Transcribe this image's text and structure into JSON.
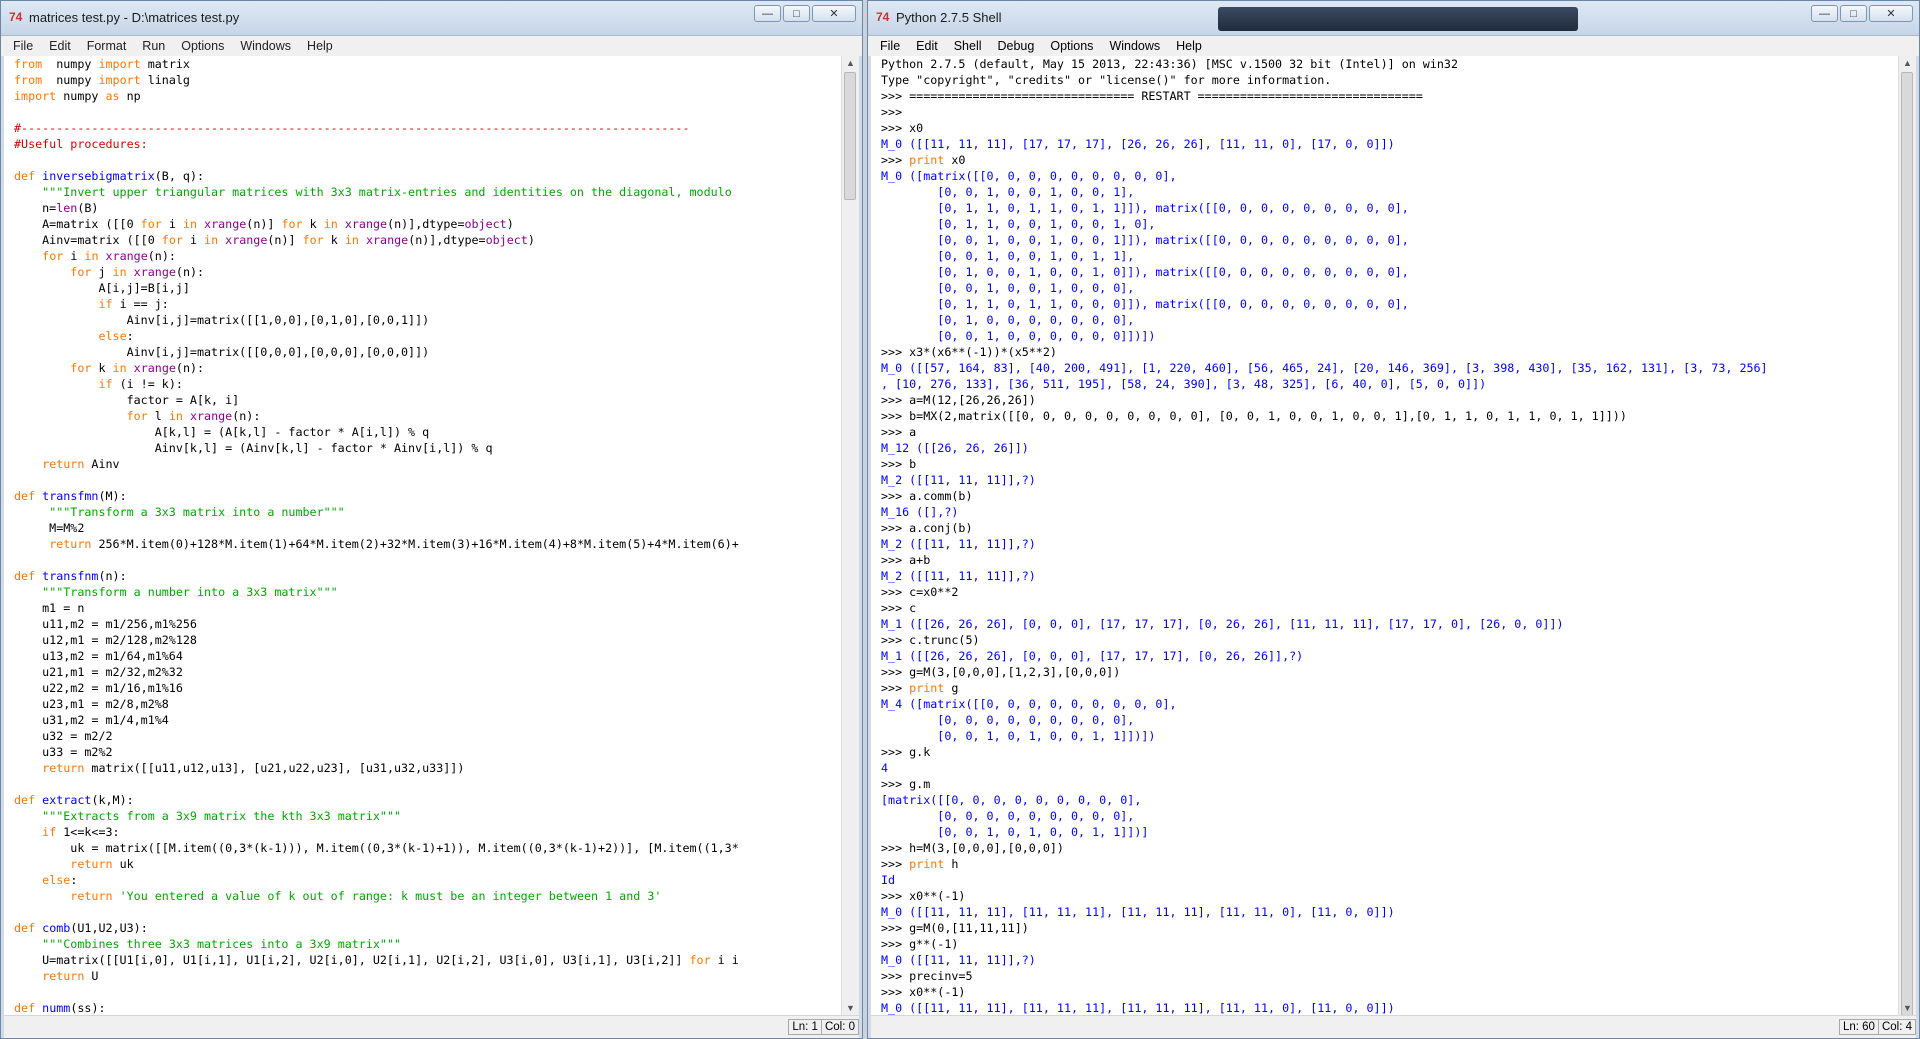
{
  "left_window": {
    "title": "matrices test.py - D:\\matrices test.py",
    "menu": [
      "File",
      "Edit",
      "Format",
      "Run",
      "Options",
      "Windows",
      "Help"
    ],
    "status": {
      "line": "Ln: 1",
      "col": "Col: 0"
    },
    "code_lines": [
      [
        [
          "kw",
          "from"
        ],
        [
          "",
          "  numpy "
        ],
        [
          "kw",
          "import"
        ],
        [
          "",
          " matrix"
        ]
      ],
      [
        [
          "kw",
          "from"
        ],
        [
          "",
          "  numpy "
        ],
        [
          "kw",
          "import"
        ],
        [
          "",
          " linalg"
        ]
      ],
      [
        [
          "kw",
          "import"
        ],
        [
          "",
          " numpy "
        ],
        [
          "kw",
          "as"
        ],
        [
          "",
          " np"
        ]
      ],
      [],
      [
        [
          "cm",
          "#-----------------------------------------------------------------------------------------------"
        ]
      ],
      [
        [
          "cm",
          "#Useful procedures:"
        ]
      ],
      [],
      [
        [
          "kw",
          "def"
        ],
        [
          "",
          " "
        ],
        [
          "df",
          "inversebigmatrix"
        ],
        [
          "",
          "(B, q):"
        ]
      ],
      [
        [
          "",
          "    "
        ],
        [
          "st",
          "\"\"\"Invert upper triangular matrices with 3x3 matrix-entries and identities on the diagonal, modulo"
        ]
      ],
      [
        [
          "",
          "    n="
        ],
        [
          "bi",
          "len"
        ],
        [
          "",
          "(B)"
        ]
      ],
      [
        [
          "",
          "    A=matrix ([[0 "
        ],
        [
          "kw",
          "for"
        ],
        [
          "",
          " i "
        ],
        [
          "kw",
          "in"
        ],
        [
          "",
          " "
        ],
        [
          "bi",
          "xrange"
        ],
        [
          "",
          "(n)] "
        ],
        [
          "kw",
          "for"
        ],
        [
          "",
          " k "
        ],
        [
          "kw",
          "in"
        ],
        [
          "",
          " "
        ],
        [
          "bi",
          "xrange"
        ],
        [
          "",
          "(n)],dtype="
        ],
        [
          "bi",
          "object"
        ],
        [
          "",
          ")"
        ]
      ],
      [
        [
          "",
          "    Ainv=matrix ([[0 "
        ],
        [
          "kw",
          "for"
        ],
        [
          "",
          " i "
        ],
        [
          "kw",
          "in"
        ],
        [
          "",
          " "
        ],
        [
          "bi",
          "xrange"
        ],
        [
          "",
          "(n)] "
        ],
        [
          "kw",
          "for"
        ],
        [
          "",
          " k "
        ],
        [
          "kw",
          "in"
        ],
        [
          "",
          " "
        ],
        [
          "bi",
          "xrange"
        ],
        [
          "",
          "(n)],dtype="
        ],
        [
          "bi",
          "object"
        ],
        [
          "",
          ")"
        ]
      ],
      [
        [
          "",
          "    "
        ],
        [
          "kw",
          "for"
        ],
        [
          "",
          " i "
        ],
        [
          "kw",
          "in"
        ],
        [
          "",
          " "
        ],
        [
          "bi",
          "xrange"
        ],
        [
          "",
          "(n):"
        ]
      ],
      [
        [
          "",
          "        "
        ],
        [
          "kw",
          "for"
        ],
        [
          "",
          " j "
        ],
        [
          "kw",
          "in"
        ],
        [
          "",
          " "
        ],
        [
          "bi",
          "xrange"
        ],
        [
          "",
          "(n):"
        ]
      ],
      [
        [
          "",
          "            A[i,j]=B[i,j]"
        ]
      ],
      [
        [
          "",
          "            "
        ],
        [
          "kw",
          "if"
        ],
        [
          "",
          " i == j:"
        ]
      ],
      [
        [
          "",
          "                Ainv[i,j]=matrix([[1,0,0],[0,1,0],[0,0,1]])"
        ]
      ],
      [
        [
          "",
          "            "
        ],
        [
          "kw",
          "else"
        ],
        [
          "",
          ":"
        ]
      ],
      [
        [
          "",
          "                Ainv[i,j]=matrix([[0,0,0],[0,0,0],[0,0,0]])"
        ]
      ],
      [
        [
          "",
          "        "
        ],
        [
          "kw",
          "for"
        ],
        [
          "",
          " k "
        ],
        [
          "kw",
          "in"
        ],
        [
          "",
          " "
        ],
        [
          "bi",
          "xrange"
        ],
        [
          "",
          "(n):"
        ]
      ],
      [
        [
          "",
          "            "
        ],
        [
          "kw",
          "if"
        ],
        [
          "",
          " (i != k):"
        ]
      ],
      [
        [
          "",
          "                factor = A[k, i]"
        ]
      ],
      [
        [
          "",
          "                "
        ],
        [
          "kw",
          "for"
        ],
        [
          "",
          " l "
        ],
        [
          "kw",
          "in"
        ],
        [
          "",
          " "
        ],
        [
          "bi",
          "xrange"
        ],
        [
          "",
          "(n):"
        ]
      ],
      [
        [
          "",
          "                    A[k,l] = (A[k,l] - factor * A[i,l]) % q"
        ]
      ],
      [
        [
          "",
          "                    Ainv[k,l] = (Ainv[k,l] - factor * Ainv[i,l]) % q"
        ]
      ],
      [
        [
          "",
          "    "
        ],
        [
          "kw",
          "return"
        ],
        [
          "",
          " Ainv"
        ]
      ],
      [],
      [
        [
          "kw",
          "def"
        ],
        [
          "",
          " "
        ],
        [
          "df",
          "transfmn"
        ],
        [
          "",
          "(M):"
        ]
      ],
      [
        [
          "",
          "     "
        ],
        [
          "st",
          "\"\"\"Transform a 3x3 matrix into a number\"\"\""
        ]
      ],
      [
        [
          "",
          "     M=M%2"
        ]
      ],
      [
        [
          "",
          "     "
        ],
        [
          "kw",
          "return"
        ],
        [
          "",
          " 256*M.item(0)+128*M.item(1)+64*M.item(2)+32*M.item(3)+16*M.item(4)+8*M.item(5)+4*M.item(6)+"
        ]
      ],
      [],
      [
        [
          "kw",
          "def"
        ],
        [
          "",
          " "
        ],
        [
          "df",
          "transfnm"
        ],
        [
          "",
          "(n):"
        ]
      ],
      [
        [
          "",
          "    "
        ],
        [
          "st",
          "\"\"\"Transform a number into a 3x3 matrix\"\"\""
        ]
      ],
      [
        [
          "",
          "    m1 = n"
        ]
      ],
      [
        [
          "",
          "    u11,m2 = m1/256,m1%256"
        ]
      ],
      [
        [
          "",
          "    u12,m1 = m2/128,m2%128"
        ]
      ],
      [
        [
          "",
          "    u13,m2 = m1/64,m1%64"
        ]
      ],
      [
        [
          "",
          "    u21,m1 = m2/32,m2%32"
        ]
      ],
      [
        [
          "",
          "    u22,m2 = m1/16,m1%16"
        ]
      ],
      [
        [
          "",
          "    u23,m1 = m2/8,m2%8"
        ]
      ],
      [
        [
          "",
          "    u31,m2 = m1/4,m1%4"
        ]
      ],
      [
        [
          "",
          "    u32 = m2/2"
        ]
      ],
      [
        [
          "",
          "    u33 = m2%2"
        ]
      ],
      [
        [
          "",
          "    "
        ],
        [
          "kw",
          "return"
        ],
        [
          "",
          " matrix([[u11,u12,u13], [u21,u22,u23], [u31,u32,u33]])"
        ]
      ],
      [],
      [
        [
          "kw",
          "def"
        ],
        [
          "",
          " "
        ],
        [
          "df",
          "extract"
        ],
        [
          "",
          "(k,M):"
        ]
      ],
      [
        [
          "",
          "    "
        ],
        [
          "st",
          "\"\"\"Extracts from a 3x9 matrix the kth 3x3 matrix\"\"\""
        ]
      ],
      [
        [
          "",
          "    "
        ],
        [
          "kw",
          "if"
        ],
        [
          "",
          " 1<=k<=3:"
        ]
      ],
      [
        [
          "",
          "        uk = matrix([[M.item((0,3*(k-1))), M.item((0,3*(k-1)+1)), M.item((0,3*(k-1)+2))], [M.item((1,3*"
        ]
      ],
      [
        [
          "",
          "        "
        ],
        [
          "kw",
          "return"
        ],
        [
          "",
          " uk"
        ]
      ],
      [
        [
          "",
          "    "
        ],
        [
          "kw",
          "else"
        ],
        [
          "",
          ":"
        ]
      ],
      [
        [
          "",
          "        "
        ],
        [
          "kw",
          "return"
        ],
        [
          "",
          " "
        ],
        [
          "st",
          "'You entered a value of k out of range: k must be an integer between 1 and 3'"
        ]
      ],
      [],
      [
        [
          "kw",
          "def"
        ],
        [
          "",
          " "
        ],
        [
          "df",
          "comb"
        ],
        [
          "",
          "(U1,U2,U3):"
        ]
      ],
      [
        [
          "",
          "    "
        ],
        [
          "st",
          "\"\"\"Combines three 3x3 matrices into a 3x9 matrix\"\"\""
        ]
      ],
      [
        [
          "",
          "    U=matrix([[U1[i,0], U1[i,1], U1[i,2], U2[i,0], U2[i,1], U2[i,2], U3[i,0], U3[i,1], U3[i,2]] "
        ],
        [
          "kw",
          "for"
        ],
        [
          "",
          " i i"
        ]
      ],
      [
        [
          "",
          "    "
        ],
        [
          "kw",
          "return"
        ],
        [
          "",
          " U"
        ]
      ],
      [],
      [
        [
          "kw",
          "def"
        ],
        [
          "",
          " "
        ],
        [
          "df",
          "numm"
        ],
        [
          "",
          "(ss):"
        ]
      ]
    ]
  },
  "right_window": {
    "title": "Python 2.7.5 Shell",
    "menu": [
      "File",
      "Edit",
      "Shell",
      "Debug",
      "Options",
      "Windows",
      "Help"
    ],
    "status": {
      "line": "Ln: 60",
      "col": "Col: 4"
    },
    "shell_lines": [
      [
        [
          "",
          "Python 2.7.5 (default, May 15 2013, 22:43:36) [MSC v.1500 32 bit (Intel)] on win32"
        ]
      ],
      [
        [
          "",
          "Type \"copyright\", \"credits\" or \"license()\" for more information."
        ]
      ],
      [
        [
          "",
          ">>> ================================ RESTART ================================"
        ]
      ],
      [
        [
          "",
          ">>> "
        ]
      ],
      [
        [
          "",
          ">>> x0"
        ]
      ],
      [
        [
          "out",
          "M_0 ([[11, 11, 11], [17, 17, 17], [26, 26, 26], [11, 11, 0], [17, 0, 0]])"
        ]
      ],
      [
        [
          "",
          ">>> "
        ],
        [
          "kw",
          "print"
        ],
        [
          "",
          " x0"
        ]
      ],
      [
        [
          "out",
          "M_0 ([matrix([[0, 0, 0, 0, 0, 0, 0, 0, 0],"
        ]
      ],
      [
        [
          "out",
          "        [0, 0, 1, 0, 0, 1, 0, 0, 1],"
        ]
      ],
      [
        [
          "out",
          "        [0, 1, 1, 0, 1, 1, 0, 1, 1]]), matrix([[0, 0, 0, 0, 0, 0, 0, 0, 0],"
        ]
      ],
      [
        [
          "out",
          "        [0, 1, 1, 0, 0, 1, 0, 0, 1, 0],"
        ]
      ],
      [
        [
          "out",
          "        [0, 0, 1, 0, 0, 1, 0, 0, 1]]), matrix([[0, 0, 0, 0, 0, 0, 0, 0, 0],"
        ]
      ],
      [
        [
          "out",
          "        [0, 0, 1, 0, 0, 1, 0, 1, 1],"
        ]
      ],
      [
        [
          "out",
          "        [0, 1, 0, 0, 1, 0, 0, 1, 0]]), matrix([[0, 0, 0, 0, 0, 0, 0, 0, 0],"
        ]
      ],
      [
        [
          "out",
          "        [0, 0, 1, 0, 0, 1, 0, 0, 0],"
        ]
      ],
      [
        [
          "out",
          "        [0, 1, 1, 0, 1, 1, 0, 0, 0]]), matrix([[0, 0, 0, 0, 0, 0, 0, 0, 0],"
        ]
      ],
      [
        [
          "out",
          "        [0, 1, 0, 0, 0, 0, 0, 0, 0],"
        ]
      ],
      [
        [
          "out",
          "        [0, 0, 1, 0, 0, 0, 0, 0, 0]])])"
        ]
      ],
      [
        [
          "",
          ">>> x3*(x6**(-1))*(x5**2)"
        ]
      ],
      [
        [
          "out",
          "M_0 ([[57, 164, 83], [40, 200, 491], [1, 220, 460], [56, 465, 24], [20, 146, 369], [3, 398, 430], [35, 162, 131], [3, 73, 256]"
        ]
      ],
      [
        [
          "out",
          ", [10, 276, 133], [36, 511, 195], [58, 24, 390], [3, 48, 325], [6, 40, 0], [5, 0, 0]])"
        ]
      ],
      [
        [
          "",
          ">>> a=M(12,[26,26,26])"
        ]
      ],
      [
        [
          "",
          ">>> b=MX(2,matrix([[0, 0, 0, 0, 0, 0, 0, 0, 0], [0, 0, 1, 0, 0, 1, 0, 0, 1],[0, 1, 1, 0, 1, 1, 0, 1, 1]]))"
        ]
      ],
      [
        [
          "",
          ">>> a"
        ]
      ],
      [
        [
          "out",
          "M_12 ([[26, 26, 26]])"
        ]
      ],
      [
        [
          "",
          ">>> b"
        ]
      ],
      [
        [
          "out",
          "M_2 ([[11, 11, 11]],?)"
        ]
      ],
      [
        [
          "",
          ">>> a.comm(b)"
        ]
      ],
      [
        [
          "out",
          "M_16 ([],?)"
        ]
      ],
      [
        [
          "",
          ">>> a.conj(b)"
        ]
      ],
      [
        [
          "out",
          "M_2 ([[11, 11, 11]],?)"
        ]
      ],
      [
        [
          "",
          ">>> a+b"
        ]
      ],
      [
        [
          "out",
          "M_2 ([[11, 11, 11]],?)"
        ]
      ],
      [
        [
          "",
          ">>> c=x0**2"
        ]
      ],
      [
        [
          "",
          ">>> c"
        ]
      ],
      [
        [
          "out",
          "M_1 ([[26, 26, 26], [0, 0, 0], [17, 17, 17], [0, 26, 26], [11, 11, 11], [17, 17, 0], [26, 0, 0]])"
        ]
      ],
      [
        [
          "",
          ">>> c.trunc(5)"
        ]
      ],
      [
        [
          "out",
          "M_1 ([[26, 26, 26], [0, 0, 0], [17, 17, 17], [0, 26, 26]],?)"
        ]
      ],
      [
        [
          "",
          ">>> g=M(3,[0,0,0],[1,2,3],[0,0,0])"
        ]
      ],
      [
        [
          "",
          ">>> "
        ],
        [
          "kw",
          "print"
        ],
        [
          "",
          " g"
        ]
      ],
      [
        [
          "out",
          "M_4 ([matrix([[0, 0, 0, 0, 0, 0, 0, 0, 0],"
        ]
      ],
      [
        [
          "out",
          "        [0, 0, 0, 0, 0, 0, 0, 0, 0],"
        ]
      ],
      [
        [
          "out",
          "        [0, 0, 1, 0, 1, 0, 0, 1, 1]])])"
        ]
      ],
      [
        [
          "",
          ">>> g.k"
        ]
      ],
      [
        [
          "out",
          "4"
        ]
      ],
      [
        [
          "",
          ">>> g.m"
        ]
      ],
      [
        [
          "out",
          "[matrix([[0, 0, 0, 0, 0, 0, 0, 0, 0],"
        ]
      ],
      [
        [
          "out",
          "        [0, 0, 0, 0, 0, 0, 0, 0, 0],"
        ]
      ],
      [
        [
          "out",
          "        [0, 0, 1, 0, 1, 0, 0, 1, 1]])]"
        ]
      ],
      [
        [
          "",
          ">>> h=M(3,[0,0,0],[0,0,0])"
        ]
      ],
      [
        [
          "",
          ">>> "
        ],
        [
          "kw",
          "print"
        ],
        [
          "",
          " h"
        ]
      ],
      [
        [
          "out",
          "Id"
        ]
      ],
      [
        [
          "",
          ">>> x0**(-1)"
        ]
      ],
      [
        [
          "out",
          "M_0 ([[11, 11, 11], [11, 11, 11], [11, 11, 11], [11, 11, 0], [11, 0, 0]])"
        ]
      ],
      [
        [
          "",
          ">>> g=M(0,[11,11,11])"
        ]
      ],
      [
        [
          "",
          ">>> g**(-1)"
        ]
      ],
      [
        [
          "out",
          "M_0 ([[11, 11, 11]],?)"
        ]
      ],
      [
        [
          "",
          ">>> precinv=5"
        ]
      ],
      [
        [
          "",
          ">>> x0**(-1)"
        ]
      ],
      [
        [
          "out",
          "M_0 ([[11, 11, 11], [11, 11, 11], [11, 11, 11], [11, 11, 0], [11, 0, 0]])"
        ]
      ]
    ]
  },
  "window_controls": {
    "minimize": "—",
    "maximize": "□",
    "close": "✕"
  },
  "icon": "idle-icon"
}
